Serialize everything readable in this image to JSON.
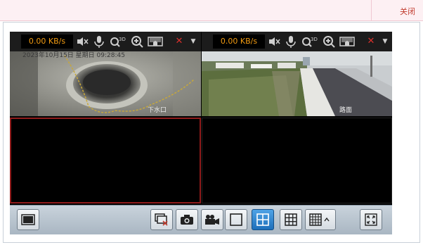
{
  "topbar": {
    "close_label": "关闭"
  },
  "panes": [
    {
      "rate": "0.00 KB/s",
      "osd": "2023年10月15日 星期日 09:28:45",
      "cam_label": "下水口",
      "active": false
    },
    {
      "rate": "0.00 KB/s",
      "osd": "",
      "cam_label": "路面",
      "active": false
    },
    {
      "active": true
    },
    {
      "active": false
    }
  ],
  "pane_toolbar_icons": [
    "mute-icon",
    "microphone-icon",
    "3d-zoom-icon",
    "zoom-in-icon",
    "record-icon",
    "close-icon",
    "dropdown-icon"
  ],
  "controls": {
    "buttons": [
      "fullscreen-single-button",
      "snapshot-close-button",
      "snapshot-button",
      "record-button",
      "layout-1-button",
      "layout-4-button",
      "layout-9-button",
      "layout-16-button",
      "layout-more-button",
      "fullscreen-button"
    ],
    "active_layout": "layout-4"
  },
  "colors": {
    "rate_text": "#f39c12",
    "close_text": "#c0392b",
    "active_border": "#8e1b1b",
    "active_button": "#1e6fba"
  }
}
